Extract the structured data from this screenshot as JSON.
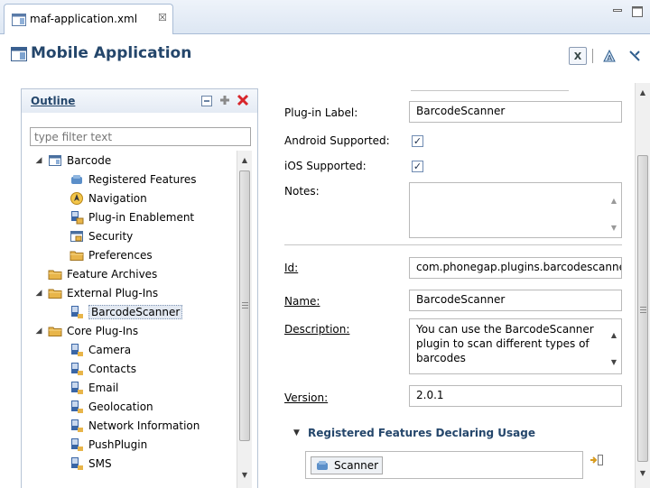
{
  "editor": {
    "tab_label": "maf-application.xml",
    "tab_close": "☒"
  },
  "header": {
    "title": "Mobile Application",
    "toolbar": {
      "source_label": "X",
      "overview_label": "A"
    }
  },
  "outline": {
    "title": "Outline",
    "filter_placeholder": "type filter text",
    "tree": [
      {
        "label": "Barcode",
        "icon": "page-icon",
        "expanded": true,
        "level": 0
      },
      {
        "label": "Registered Features",
        "icon": "feature-icon",
        "level": 1
      },
      {
        "label": "Navigation",
        "icon": "navigation-icon",
        "level": 1
      },
      {
        "label": "Plug-in Enablement",
        "icon": "plugin-lock-icon",
        "level": 1
      },
      {
        "label": "Security",
        "icon": "security-icon",
        "level": 1
      },
      {
        "label": "Preferences",
        "icon": "folder-icon",
        "level": 1
      },
      {
        "label": "Feature Archives",
        "icon": "folder-icon",
        "level": 0
      },
      {
        "label": "External Plug-Ins",
        "icon": "folder-icon",
        "expanded": true,
        "level": 0
      },
      {
        "label": "BarcodeScanner",
        "icon": "plugin-icon",
        "level": 1,
        "selected": true
      },
      {
        "label": "Core Plug-Ins",
        "icon": "folder-icon",
        "expanded": true,
        "level": 0
      },
      {
        "label": "Camera",
        "icon": "plugin-icon",
        "level": 1
      },
      {
        "label": "Contacts",
        "icon": "plugin-icon",
        "level": 1
      },
      {
        "label": "Email",
        "icon": "plugin-icon",
        "level": 1
      },
      {
        "label": "Geolocation",
        "icon": "plugin-icon",
        "level": 1
      },
      {
        "label": "Network Information",
        "icon": "plugin-icon",
        "level": 1
      },
      {
        "label": "PushPlugin",
        "icon": "plugin-icon",
        "level": 1
      },
      {
        "label": "SMS",
        "icon": "plugin-icon",
        "level": 1
      }
    ]
  },
  "details": {
    "plugin_label_label": "Plug-in Label:",
    "plugin_label_value": "BarcodeScanner",
    "android_label": "Android Supported:",
    "android_checked": true,
    "ios_label": "iOS Supported:",
    "ios_checked": true,
    "notes_label": "Notes:",
    "notes_value": "",
    "id_label": "Id:",
    "id_value": "com.phonegap.plugins.barcodescanner",
    "name_label": "Name:",
    "name_value": "BarcodeScanner",
    "description_label": "Description:",
    "description_value": "You can use the BarcodeScanner plugin to scan different types of barcodes",
    "version_label": "Version:",
    "version_value": "2.0.1",
    "section_title": "Registered Features Declaring Usage",
    "features": [
      "Scanner"
    ]
  },
  "colors": {
    "title_blue": "#24466b",
    "delete_red": "#d8262b",
    "add_green": "#3e8f3e",
    "folder_yellow": "#e8b54a",
    "plugin_blue": "#3a66a6"
  }
}
